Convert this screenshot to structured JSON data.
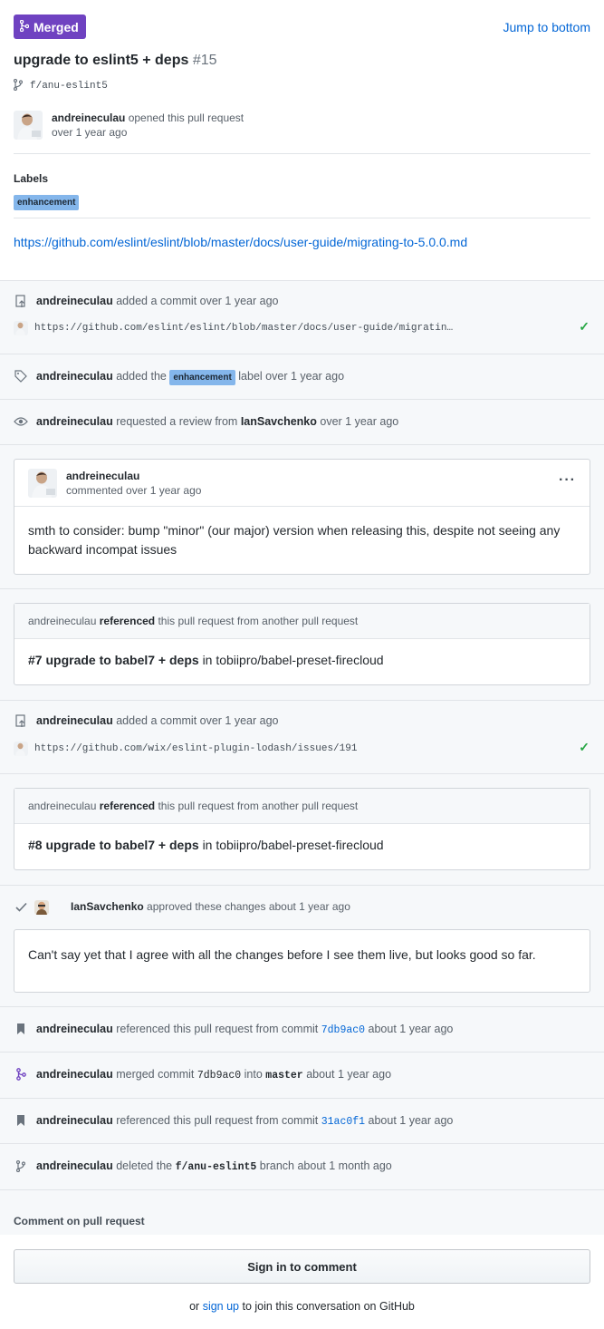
{
  "header": {
    "status_label": "Merged",
    "jump_label": "Jump to bottom",
    "title": "upgrade to eslint5 + deps",
    "number": "#15",
    "branch": "f/anu-eslint5",
    "opener_name": "andreineculau",
    "opener_action": "opened this pull request",
    "opener_time": "over 1 year ago",
    "labels_heading": "Labels",
    "label": "enhancement",
    "body_link": "https://github.com/eslint/eslint/blob/master/docs/user-guide/migrating-to-5.0.0.md"
  },
  "timeline": {
    "commit1": {
      "actor": "andreineculau",
      "action": "added a commit over 1 year ago",
      "message": "https://github.com/eslint/eslint/blob/master/docs/user-guide/migratin…"
    },
    "label_event": {
      "actor": "andreineculau",
      "before": "added the",
      "label": "enhancement",
      "after": "label over 1 year ago"
    },
    "review_request": {
      "actor": "andreineculau",
      "action": "requested a review from",
      "reviewer": "IanSavchenko",
      "time": "over 1 year ago"
    },
    "comment": {
      "author": "andreineculau",
      "meta": "commented over 1 year ago",
      "menu": "···",
      "body": "smth to consider: bump \"minor\" (our major) version when releasing this, despite not seeing any backward incompat issues"
    },
    "ref1": {
      "actor": "andreineculau",
      "verb": "referenced",
      "rest": "this pull request from another pull request",
      "link": "#7 upgrade to babel7 + deps",
      "repo": "in tobiipro/babel-preset-firecloud"
    },
    "commit2": {
      "actor": "andreineculau",
      "action": "added a commit over 1 year ago",
      "message": "https://github.com/wix/eslint-plugin-lodash/issues/191"
    },
    "ref2": {
      "actor": "andreineculau",
      "verb": "referenced",
      "rest": "this pull request from another pull request",
      "link": "#8 upgrade to babel7 + deps",
      "repo": "in tobiipro/babel-preset-firecloud"
    },
    "review": {
      "actor": "IanSavchenko",
      "action": "approved these changes about 1 year ago",
      "body": "Can't say yet that I agree with all the changes before I see them live, but looks good so far."
    },
    "commitref1": {
      "actor": "andreineculau",
      "action": "referenced this pull request from commit",
      "sha": "7db9ac0",
      "time": "about 1 year ago"
    },
    "merged": {
      "actor": "andreineculau",
      "action": "merged commit",
      "sha": "7db9ac0",
      "into": "into",
      "branch": "master",
      "time": "about 1 year ago"
    },
    "commitref2": {
      "actor": "andreineculau",
      "action": "referenced this pull request from commit",
      "sha": "31ac0f1",
      "time": "about 1 year ago"
    },
    "deleted": {
      "actor": "andreineculau",
      "action": "deleted the",
      "branch": "f/anu-eslint5",
      "after": "branch about 1 month ago"
    }
  },
  "footer": {
    "heading": "Comment on pull request",
    "signin_label": "Sign in to comment",
    "or": "or",
    "signup": "sign up",
    "rest": "to join this conversation on GitHub"
  },
  "colors": {
    "merged": "#6f42c1",
    "link": "#0366d6",
    "label": "#84b6eb",
    "success": "#28a745"
  }
}
